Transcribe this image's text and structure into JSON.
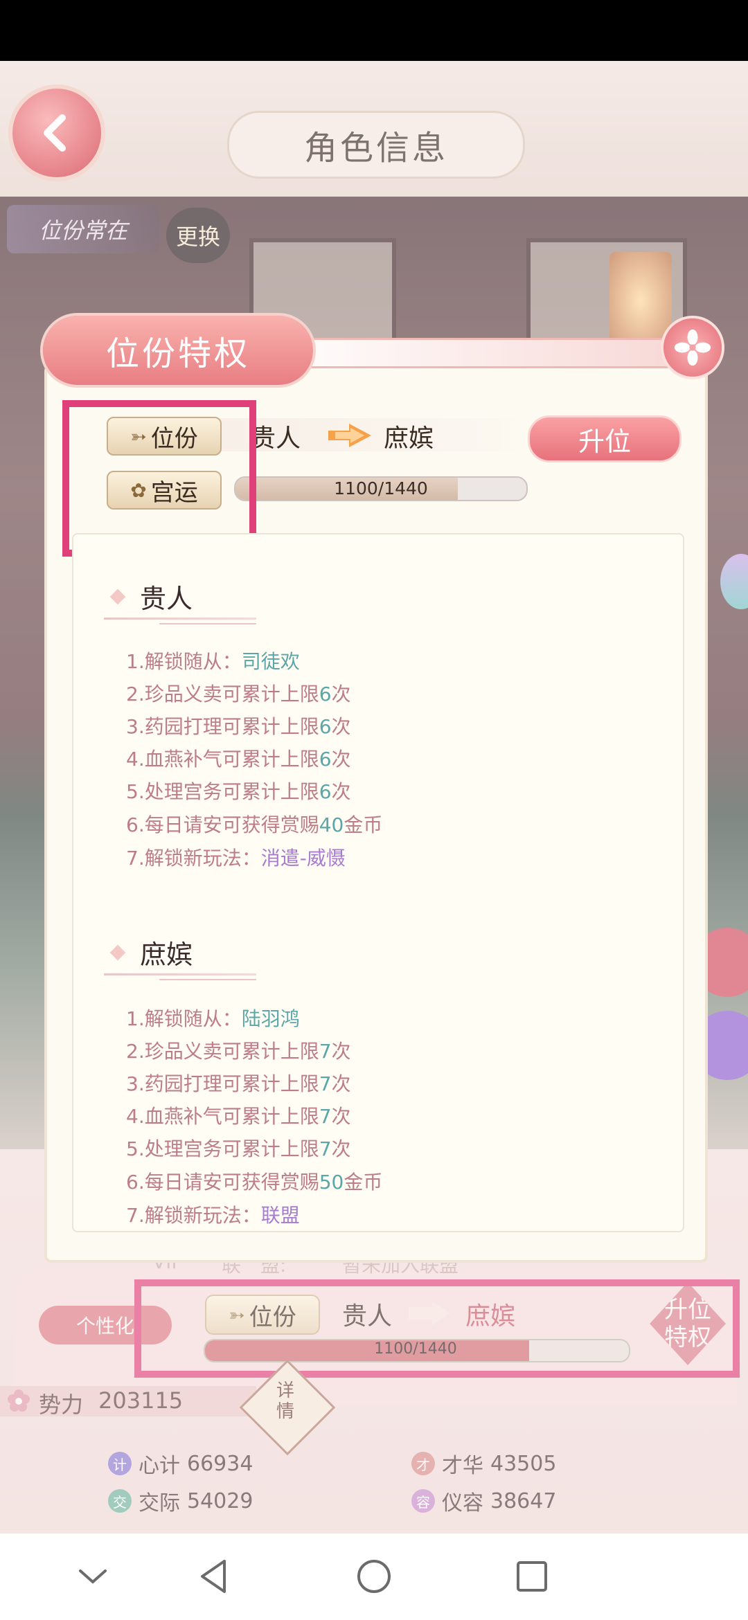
{
  "header": {
    "title": "角色信息"
  },
  "profile": {
    "rank_banner": "位份常在",
    "change_label": "更换",
    "personal_label": "个性化",
    "vip_label": "VIP",
    "alliance_label": "联　盟:",
    "alliance_value": "暂未加入联盟",
    "rank_tag_label": "位份",
    "current_rank": "贵人",
    "next_rank": "庶嫔",
    "progress_text": "1100/1440",
    "progress_fraction": 0.764,
    "upgrade_privilege_label": "升位特权",
    "power_label": "势力",
    "power_value": "203115",
    "details_label": "详情",
    "stats": [
      {
        "icon": "计",
        "label": "心计",
        "value": "66934",
        "color": "#8a7ad0"
      },
      {
        "icon": "才",
        "label": "才华",
        "value": "43505",
        "color": "#d98a8a"
      },
      {
        "icon": "交",
        "label": "交际",
        "value": "54029",
        "color": "#6fb39c"
      },
      {
        "icon": "容",
        "label": "仪容",
        "value": "38647",
        "color": "#c58ac9"
      }
    ]
  },
  "dialog": {
    "title": "位份特权",
    "rank_tag_label": "位份",
    "fortune_tag_label": "宫运",
    "current_rank": "贵人",
    "next_rank": "庶嫔",
    "promote_label": "升位",
    "fortune_progress_text": "1100/1440",
    "fortune_progress_fraction": 0.764,
    "sections": [
      {
        "title": "贵人",
        "perks": [
          {
            "prefix": "1.解锁随从：",
            "highlight": "司徒欢",
            "suffix": "",
            "hl_color": "teal"
          },
          {
            "prefix": "2.珍品义卖可累计上限",
            "highlight": "6",
            "suffix": "次",
            "hl_color": "teal"
          },
          {
            "prefix": "3.药园打理可累计上限",
            "highlight": "6",
            "suffix": "次",
            "hl_color": "teal"
          },
          {
            "prefix": "4.血燕补气可累计上限",
            "highlight": "6",
            "suffix": "次",
            "hl_color": "teal"
          },
          {
            "prefix": "5.处理宫务可累计上限",
            "highlight": "6",
            "suffix": "次",
            "hl_color": "teal"
          },
          {
            "prefix": "6.每日请安可获得赏赐",
            "highlight": "40",
            "suffix": "金币",
            "hl_color": "teal"
          },
          {
            "prefix": "7.解锁新玩法：",
            "highlight": "消遣-威慑",
            "suffix": "",
            "hl_color": "purple"
          }
        ]
      },
      {
        "title": "庶嫔",
        "perks": [
          {
            "prefix": "1.解锁随从：",
            "highlight": "陆羽鸿",
            "suffix": "",
            "hl_color": "teal"
          },
          {
            "prefix": "2.珍品义卖可累计上限",
            "highlight": "7",
            "suffix": "次",
            "hl_color": "teal"
          },
          {
            "prefix": "3.药园打理可累计上限",
            "highlight": "7",
            "suffix": "次",
            "hl_color": "teal"
          },
          {
            "prefix": "4.血燕补气可累计上限",
            "highlight": "7",
            "suffix": "次",
            "hl_color": "teal"
          },
          {
            "prefix": "5.处理宫务可累计上限",
            "highlight": "7",
            "suffix": "次",
            "hl_color": "teal"
          },
          {
            "prefix": "6.每日请安可获得赏赐",
            "highlight": "50",
            "suffix": "金币",
            "hl_color": "teal"
          },
          {
            "prefix": "7.解锁新玩法：",
            "highlight": "联盟",
            "suffix": "",
            "hl_color": "purple"
          }
        ]
      }
    ]
  },
  "colors": {
    "highlight_box": "#e0407a",
    "accent_pink": "#e8727c",
    "teal_text": "#5aa6a8",
    "purple_text": "#a77bd0"
  }
}
